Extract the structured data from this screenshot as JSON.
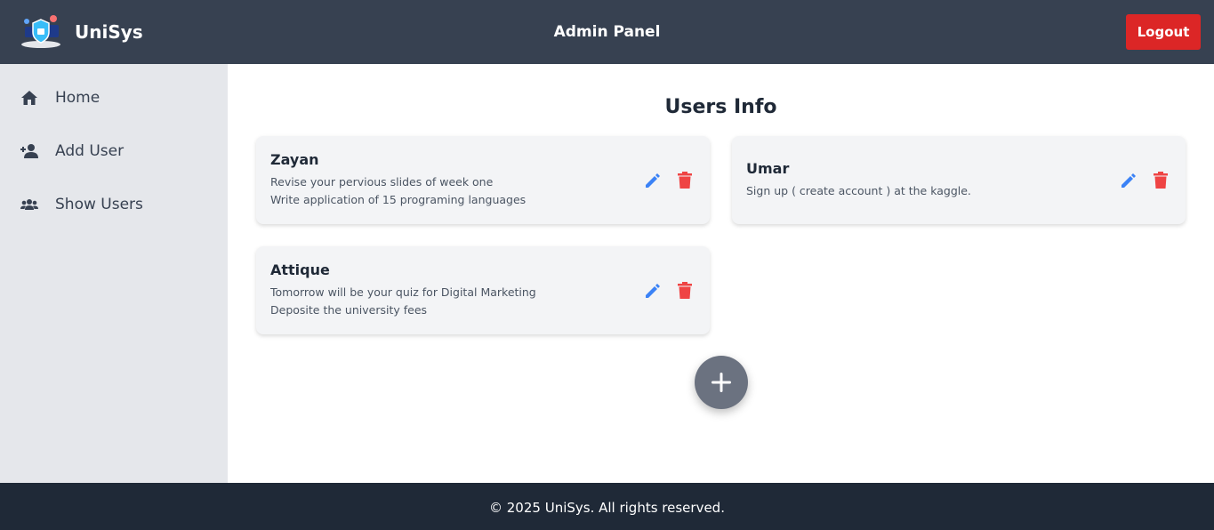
{
  "header": {
    "brand_name": "UniSys",
    "logo_icon": "unisys-logo-icon",
    "title": "Admin Panel",
    "logout_label": "Logout"
  },
  "sidebar": {
    "items": [
      {
        "label": "Home",
        "icon": "home-icon"
      },
      {
        "label": "Add User",
        "icon": "add-user-icon"
      },
      {
        "label": "Show Users",
        "icon": "users-icon"
      }
    ]
  },
  "main": {
    "title": "Users Info",
    "users": [
      {
        "name": "Zayan",
        "notes": [
          "Revise your pervious slides of week one",
          "Write application of 15 programing languages"
        ]
      },
      {
        "name": "Umar",
        "notes": [
          "Sign up ( create account ) at the kaggle."
        ]
      },
      {
        "name": "Attique",
        "notes": [
          "Tomorrow will be your quiz for Digital Marketing",
          "Deposite the university fees"
        ]
      }
    ],
    "add_icon": "plus-icon"
  },
  "footer": {
    "text": "© 2025 UniSys. All rights reserved."
  },
  "colors": {
    "header_bg": "#374151",
    "sidebar_bg": "#e5e7eb",
    "card_bg": "#f3f4f6",
    "logout": "#dc2626",
    "edit_icon": "#3b82f6",
    "delete_icon": "#ef4444",
    "fab": "#6b7280",
    "footer_bg": "#1f2937"
  }
}
